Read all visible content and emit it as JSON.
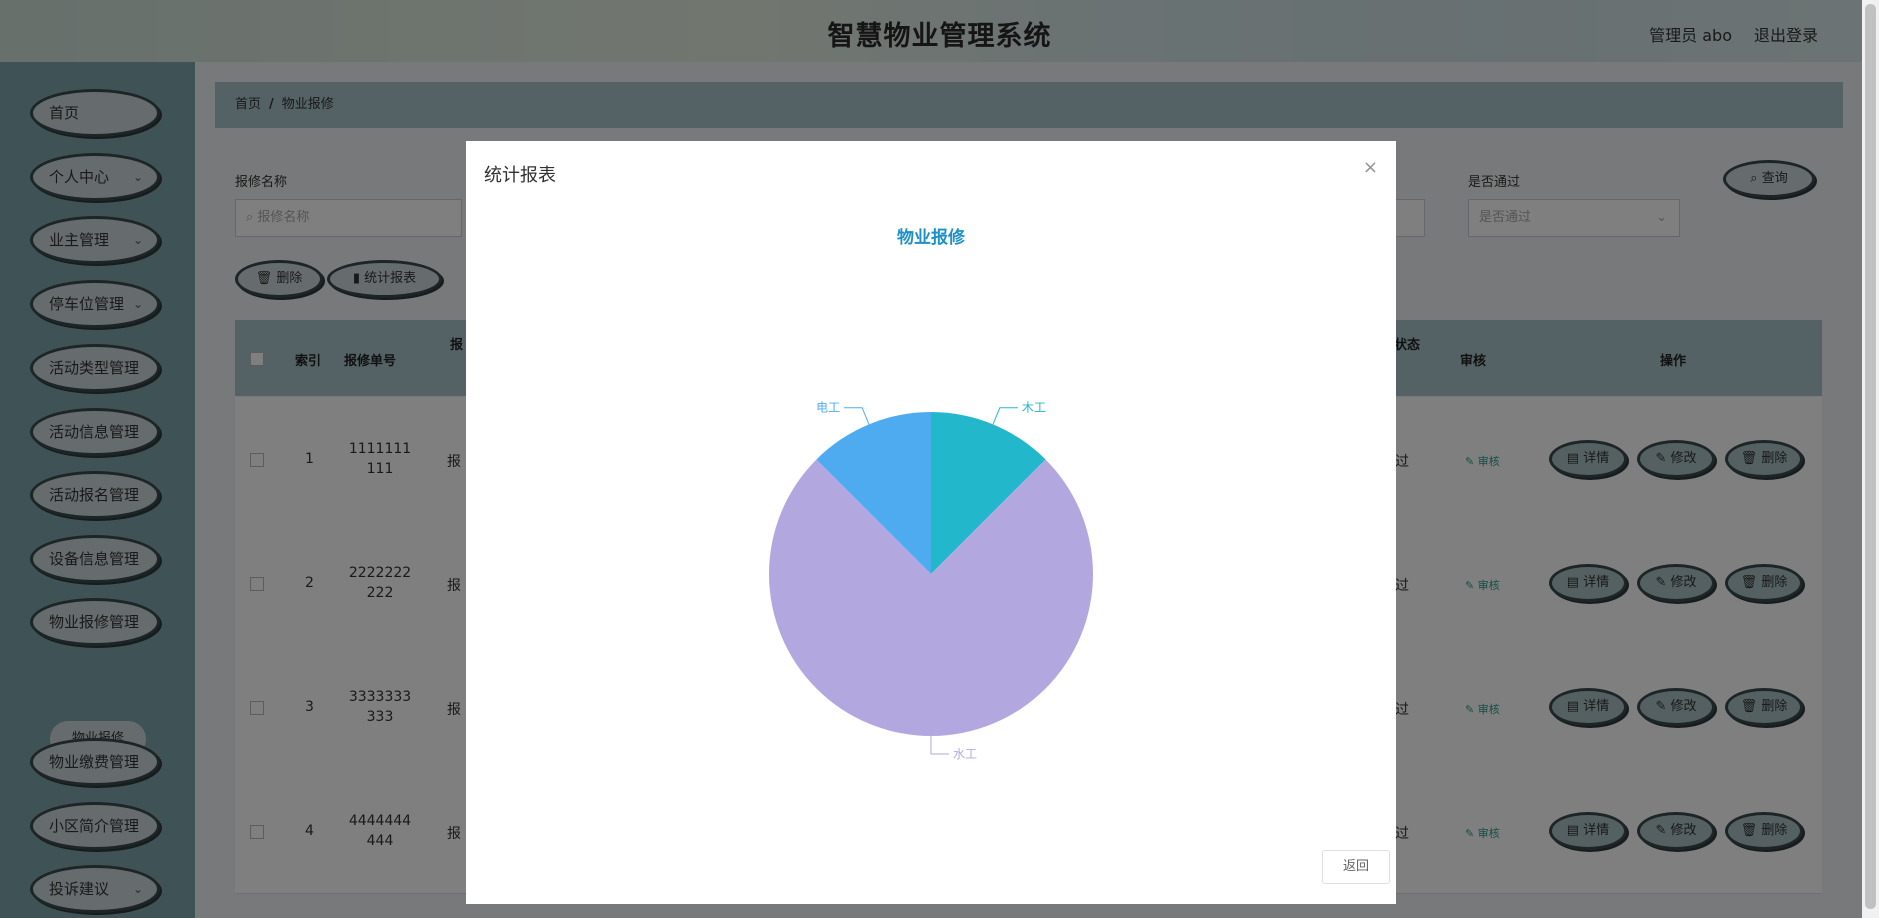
{
  "header": {
    "title": "智慧物业管理系统",
    "user": "管理员 abo",
    "logout": "退出登录"
  },
  "sidebar": {
    "items": [
      {
        "label": "首页",
        "chevron": false
      },
      {
        "label": "个人中心",
        "chevron": true
      },
      {
        "label": "业主管理",
        "chevron": true
      },
      {
        "label": "停车位管理",
        "chevron": true
      },
      {
        "label": "活动类型管理",
        "chevron": false
      },
      {
        "label": "活动信息管理",
        "chevron": false
      },
      {
        "label": "活动报名管理",
        "chevron": false
      },
      {
        "label": "设备信息管理",
        "chevron": false
      },
      {
        "label": "物业报修管理",
        "chevron": false
      },
      {
        "label": "物业缴费管理",
        "chevron": false
      },
      {
        "label": "小区简介管理",
        "chevron": false
      },
      {
        "label": "投诉建议",
        "chevron": true
      }
    ],
    "submenu": "物业报修"
  },
  "breadcrumb": {
    "home": "首页",
    "sep": "/",
    "current": "物业报修"
  },
  "search": {
    "name_label": "报修名称",
    "name_placeholder": "报修名称",
    "pass_label": "是否通过",
    "pass_placeholder": "是否通过",
    "query_btn": "查询"
  },
  "toolbar": {
    "delete": "删除",
    "stats": "统计报表"
  },
  "table": {
    "headers": {
      "index": "索引",
      "order_no": "报修单号",
      "col3": "报",
      "status": "状态",
      "audit": "审核",
      "ops": "操作"
    },
    "rows": [
      {
        "index": "1",
        "order_no": "1111111111",
        "col3": "报"
      },
      {
        "index": "2",
        "order_no": "2222222222",
        "col3": "报"
      },
      {
        "index": "3",
        "order_no": "3333333333",
        "col3": "报"
      },
      {
        "index": "4",
        "order_no": "4444444444",
        "col3": "报"
      }
    ],
    "status_fragment": "过",
    "audit_link": "审核",
    "actions": {
      "detail": "详情",
      "edit": "修改",
      "delete": "删除"
    }
  },
  "dialog": {
    "title": "统计报表",
    "close": "×",
    "back": "返回"
  },
  "chart_data": {
    "type": "pie",
    "title": "物业报修",
    "slices": [
      {
        "label": "木工",
        "value": 1,
        "color": "#23b7cb"
      },
      {
        "label": "水工",
        "value": 6,
        "color": "#b3a7e0"
      },
      {
        "label": "电工",
        "value": 1,
        "color": "#4fabf0"
      }
    ]
  }
}
